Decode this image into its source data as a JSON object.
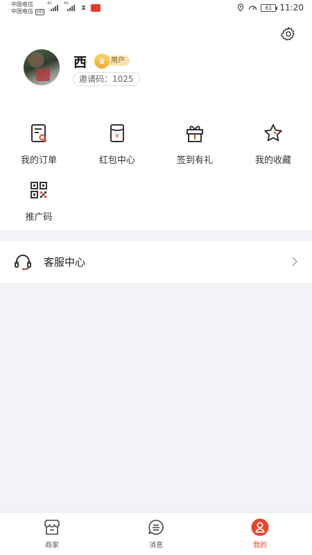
{
  "status_bar": {
    "carrier_1": "中国电信",
    "carrier_2": "中国电信",
    "hd": "HD",
    "network_1": "4G",
    "network_2": "4G",
    "battery": "61",
    "time": "11:20"
  },
  "profile": {
    "username": "西",
    "role": "用户",
    "invite_code": "邀请码：1025"
  },
  "menu": [
    {
      "label": "我的订单",
      "icon": "order-icon"
    },
    {
      "label": "红包中心",
      "icon": "red-envelope-icon"
    },
    {
      "label": "签到有礼",
      "icon": "gift-icon"
    },
    {
      "label": "我的收藏",
      "icon": "star-icon"
    },
    {
      "label": "推广码",
      "icon": "qr-code-icon"
    }
  ],
  "service": {
    "label": "客服中心",
    "icon": "headset-icon"
  },
  "bottom_nav": [
    {
      "label": "商家",
      "icon": "shop-icon",
      "active": false
    },
    {
      "label": "消息",
      "icon": "message-icon",
      "active": false
    },
    {
      "label": "我的",
      "icon": "user-icon",
      "active": true
    }
  ],
  "colors": {
    "accent": "#e8452c",
    "background": "#f2f2f7",
    "badge_gold": "#f0a92c"
  }
}
